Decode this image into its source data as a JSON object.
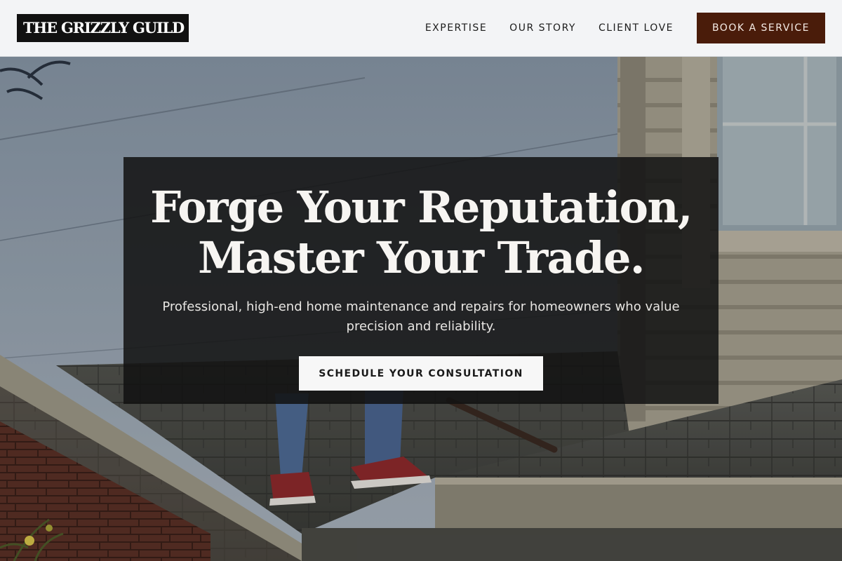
{
  "header": {
    "logo_text": "THE GRIZZLY GUILD",
    "nav": [
      {
        "label": "EXPERTISE"
      },
      {
        "label": "OUR STORY"
      },
      {
        "label": "CLIENT LOVE"
      }
    ],
    "cta_label": "BOOK A SERVICE"
  },
  "hero": {
    "title_line1": "Forge Your Reputation,",
    "title_line2": "Master Your Trade.",
    "subtitle": "Professional, high-end home maintenance and repairs for homeowners who value precision and reliability.",
    "cta_label": "SCHEDULE YOUR CONSULTATION"
  },
  "colors": {
    "header_bg": "#f3f4f6",
    "logo_bg": "#111111",
    "book_button_bg": "#4a1c0a",
    "panel_bg": "rgba(18,18,18,0.86)",
    "cta_button_bg": "#f7f7f7"
  }
}
